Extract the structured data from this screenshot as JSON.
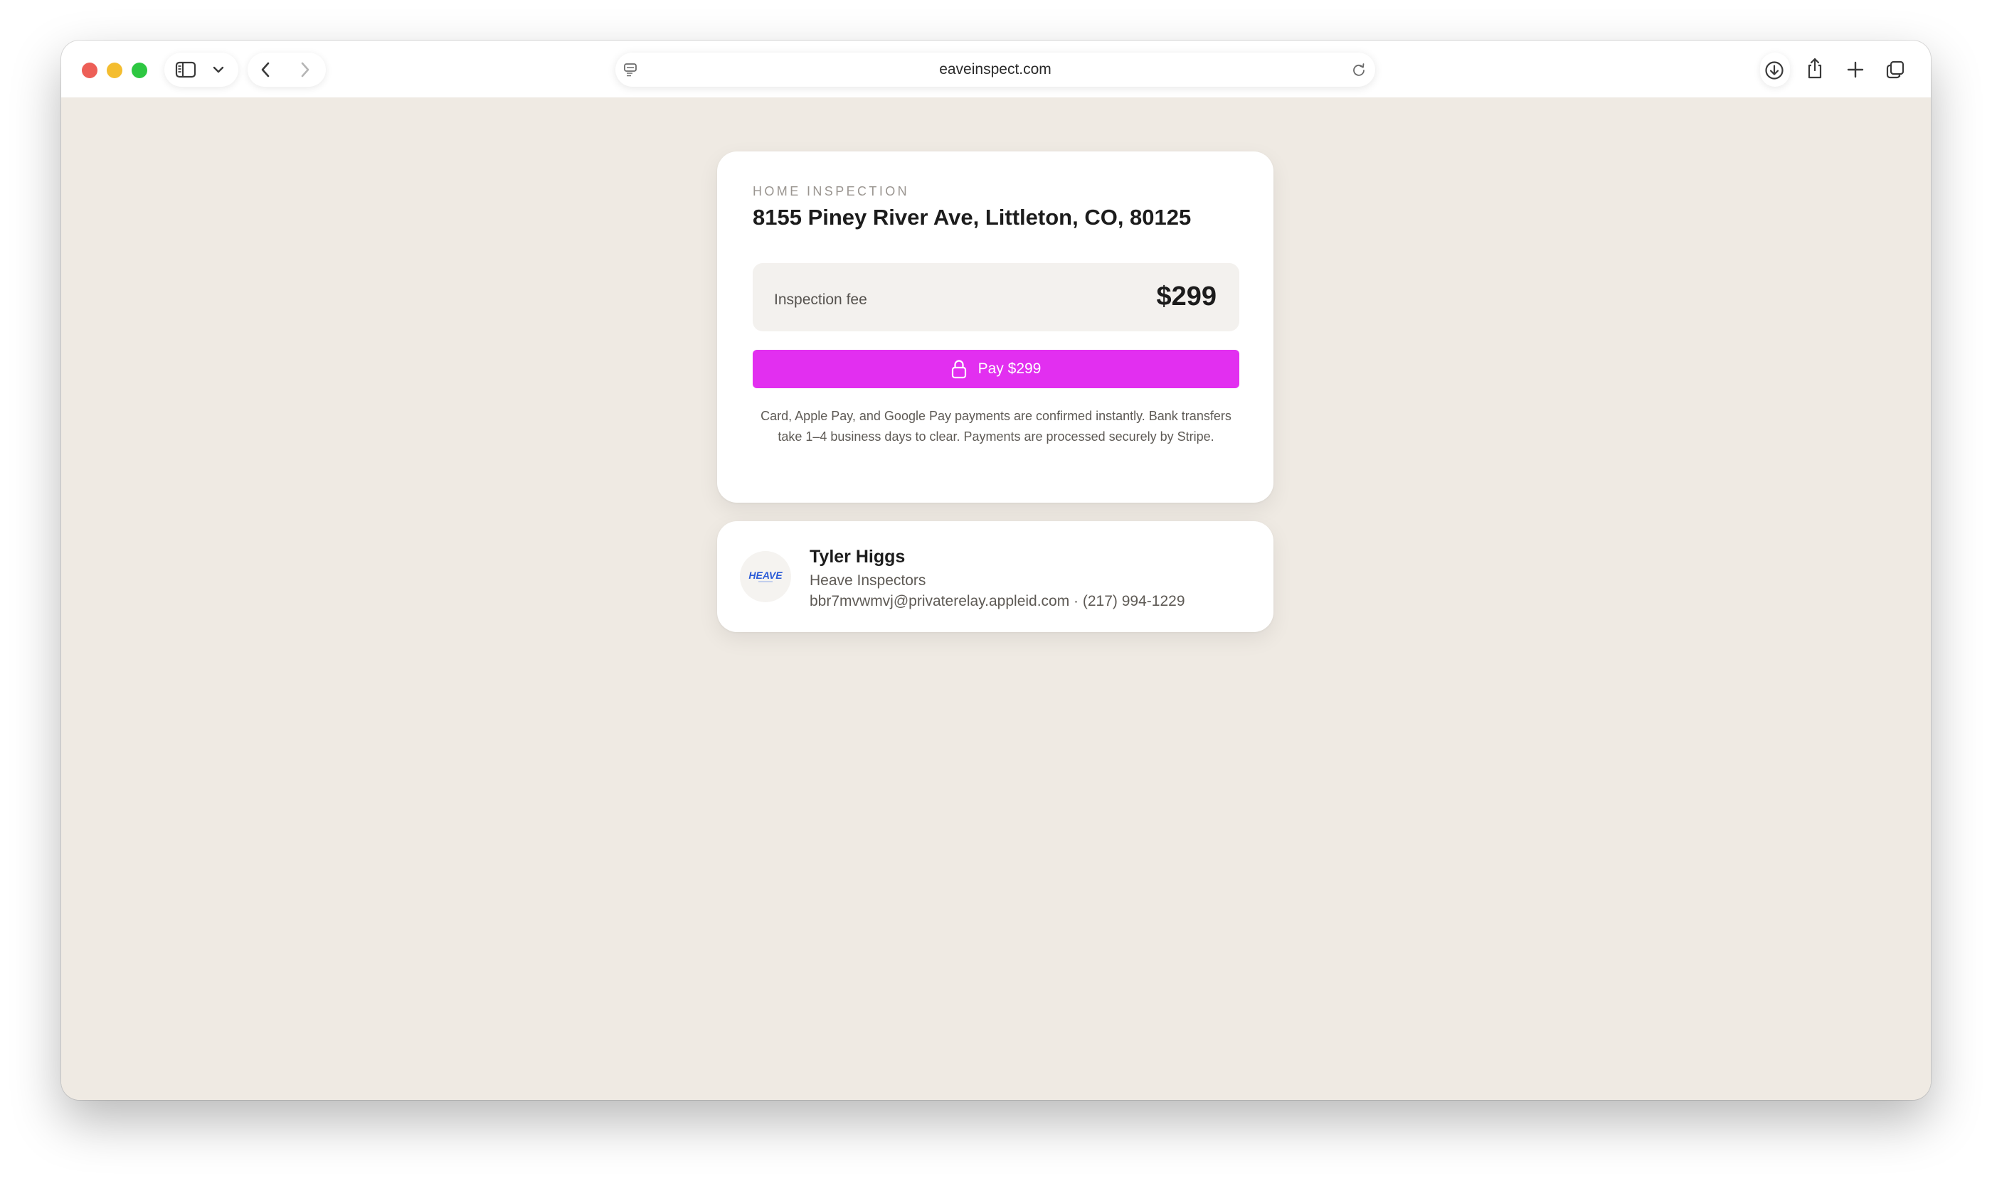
{
  "browser": {
    "url": "eaveinspect.com",
    "icons": {
      "sidebar": "sidebar-icon",
      "sidebar_menu": "chevron-down-icon",
      "back": "chevron-left-icon",
      "forward": "chevron-right-icon",
      "page_menu": "page-menu-icon",
      "reload": "reload-icon",
      "downloads": "download-icon",
      "share": "share-icon",
      "new_tab": "plus-icon",
      "tabs": "tabs-overview-icon"
    }
  },
  "invoice": {
    "eyebrow": "HOME INSPECTION",
    "address": "8155 Piney River Ave, Littleton, CO, 80125",
    "fee_label": "Inspection fee",
    "fee_amount": "$299",
    "pay_button_label": "Pay $299",
    "pay_button_icon": "lock-icon",
    "disclaimer": "Card, Apple Pay, and Google Pay payments are confirmed instantly. Bank transfers take 1–4 business days to clear. Payments are processed securely by Stripe."
  },
  "contact": {
    "logo_text": "HEAVE",
    "name": "Tyler Higgs",
    "company": "Heave Inspectors",
    "details": "bbr7mvwmvj@privaterelay.appleid.com · (217) 994-1229"
  },
  "colors": {
    "page_background": "#efeae3",
    "pay_button": "#e22ff0",
    "logo_blue": "#2a5bd7"
  }
}
